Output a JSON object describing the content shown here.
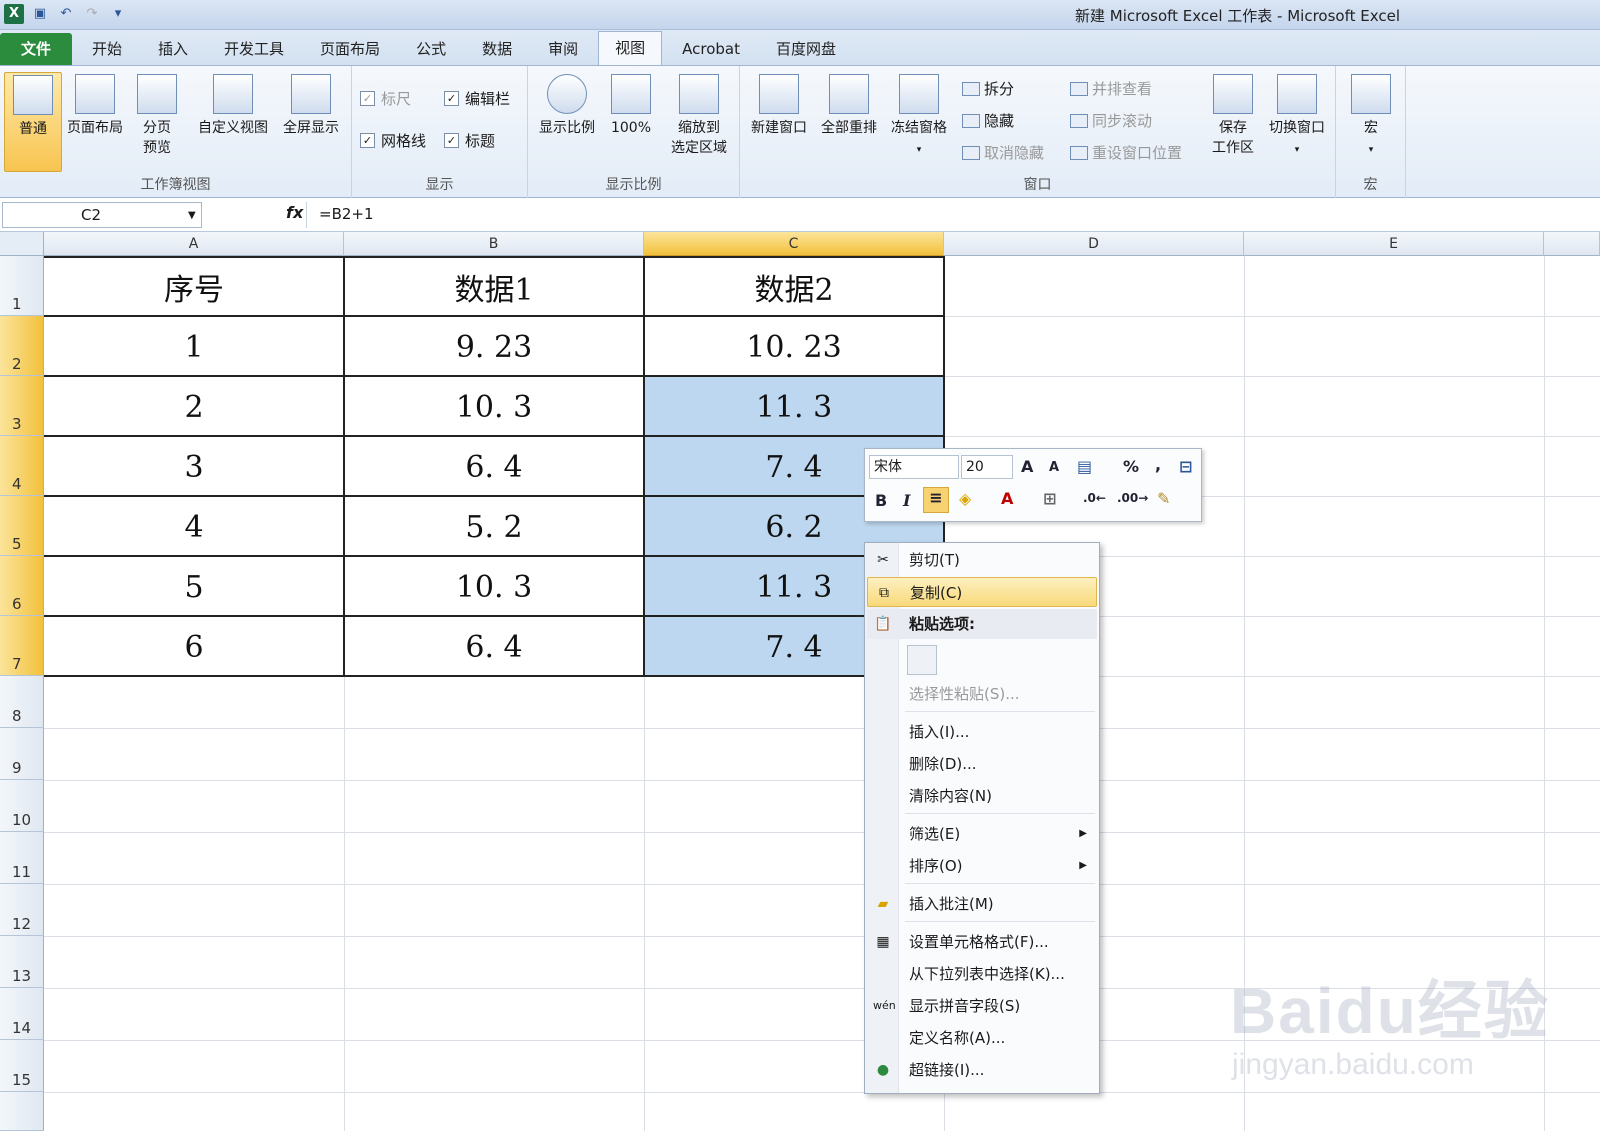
{
  "window": {
    "title": "新建 Microsoft Excel 工作表 - Microsoft Excel"
  },
  "tabs": [
    {
      "label": "文件"
    },
    {
      "label": "开始"
    },
    {
      "label": "插入"
    },
    {
      "label": "开发工具"
    },
    {
      "label": "页面布局"
    },
    {
      "label": "公式"
    },
    {
      "label": "数据"
    },
    {
      "label": "审阅"
    },
    {
      "label": "视图"
    },
    {
      "label": "Acrobat"
    },
    {
      "label": "百度网盘"
    }
  ],
  "ribbon": {
    "workbook_views": {
      "label": "工作簿视图",
      "normal": "普通",
      "page_layout": "页面布局",
      "page_break_1": "分页",
      "page_break_2": "预览",
      "custom": "自定义视图",
      "fullscreen": "全屏显示"
    },
    "show": {
      "label": "显示",
      "ruler": "标尺",
      "formula_bar": "编辑栏",
      "gridlines": "网格线",
      "headings": "标题"
    },
    "zoom": {
      "label": "显示比例",
      "zoom": "显示比例",
      "hundred": "100%",
      "zoom_sel_1": "缩放到",
      "zoom_sel_2": "选定区域"
    },
    "window": {
      "label": "窗口",
      "new_window": "新建窗口",
      "arrange": "全部重排",
      "freeze": "冻结窗格",
      "split": "拆分",
      "hide": "隐藏",
      "unhide": "取消隐藏",
      "side_by_side": "并排查看",
      "sync_scroll": "同步滚动",
      "reset_pos": "重设窗口位置",
      "save_ws_1": "保存",
      "save_ws_2": "工作区",
      "switch": "切换窗口"
    },
    "macros": {
      "label": "宏",
      "macros": "宏"
    }
  },
  "formula_bar": {
    "name_box": "C2",
    "fx": "fx",
    "formula": "=B2+1"
  },
  "columns": [
    "A",
    "B",
    "C",
    "D",
    "E"
  ],
  "rows": [
    "1",
    "2",
    "3",
    "4",
    "5",
    "6",
    "7",
    "8",
    "9",
    "10",
    "11",
    "12",
    "13",
    "14",
    "15"
  ],
  "table": {
    "headers": [
      "序号",
      "数据1",
      "数据2"
    ],
    "rows": [
      [
        "1",
        "9. 23",
        "10. 23"
      ],
      [
        "2",
        "10. 3",
        "11. 3"
      ],
      [
        "3",
        "6. 4",
        "7. 4"
      ],
      [
        "4",
        "5. 2",
        "6. 2"
      ],
      [
        "5",
        "10. 3",
        "11. 3"
      ],
      [
        "6",
        "6. 4",
        "7. 4"
      ]
    ]
  },
  "mini_toolbar": {
    "font": "宋体",
    "size": "20",
    "bold": "B",
    "italic": "I",
    "grow": "A",
    "percent": "%",
    "comma": ","
  },
  "context_menu": {
    "cut": "剪切(T)",
    "copy": "复制(C)",
    "paste_options": "粘贴选项:",
    "paste_special": "选择性粘贴(S)...",
    "insert": "插入(I)...",
    "delete": "删除(D)...",
    "clear": "清除内容(N)",
    "filter": "筛选(E)",
    "sort": "排序(O)",
    "comment": "插入批注(M)",
    "format": "设置单元格格式(F)...",
    "pick_list": "从下拉列表中选择(K)...",
    "phonetic": "显示拼音字段(S)",
    "define_name": "定义名称(A)...",
    "hyperlink": "超链接(I)..."
  },
  "watermark": {
    "main": "Baidu经验",
    "url": "jingyan.baidu.com"
  }
}
